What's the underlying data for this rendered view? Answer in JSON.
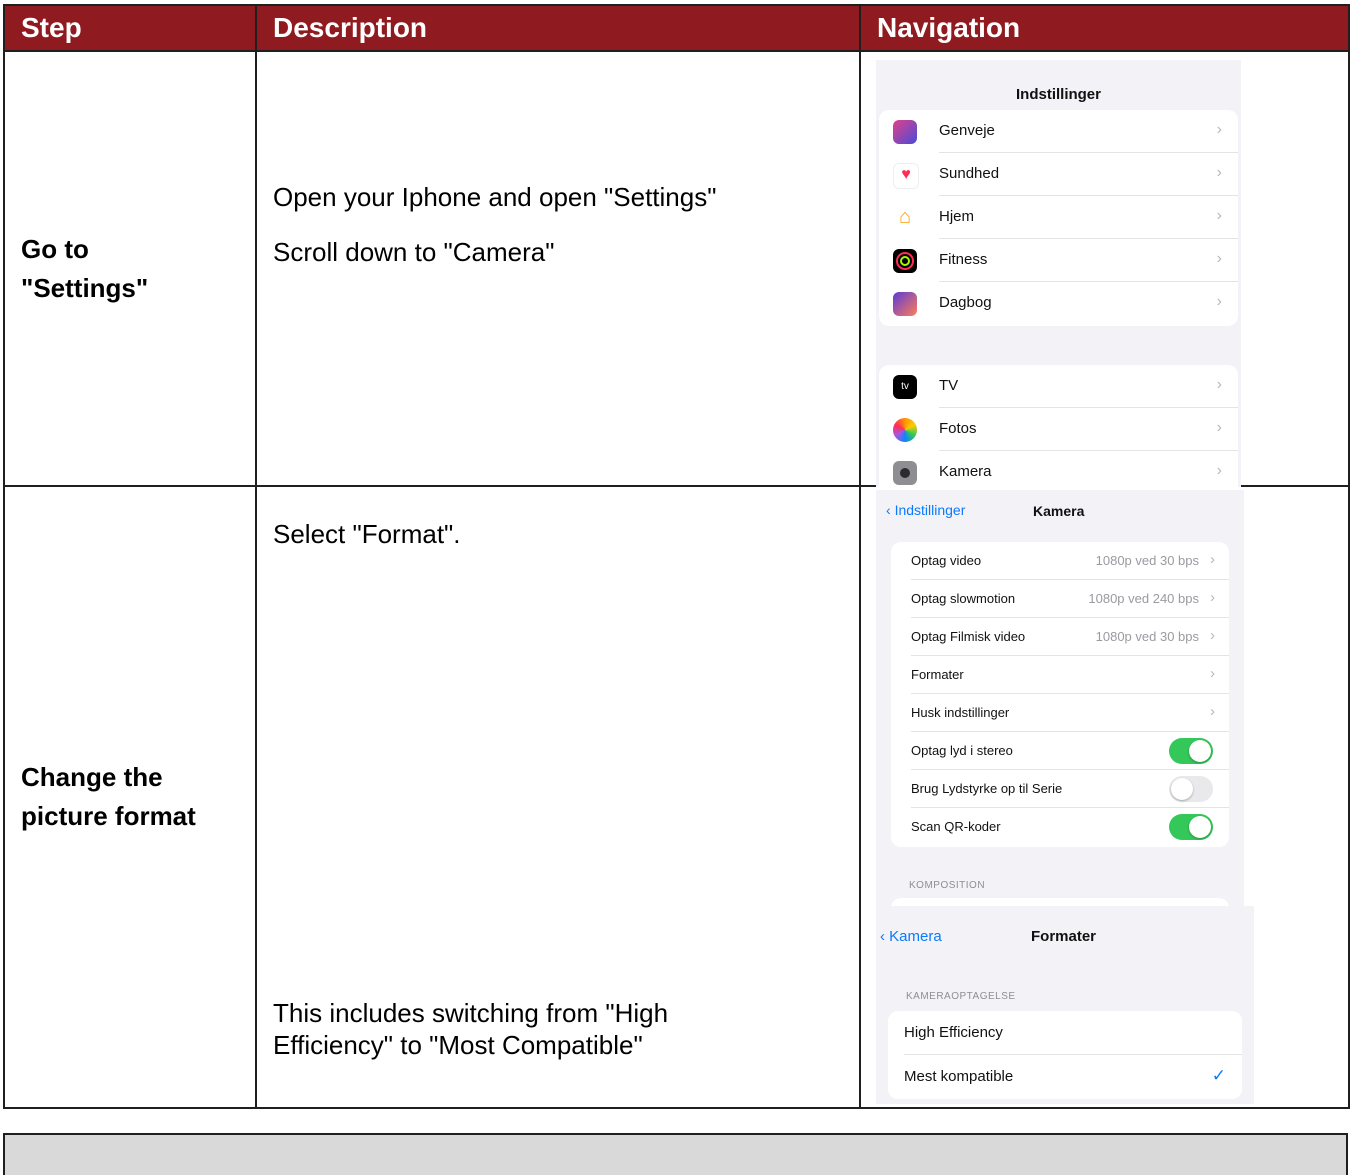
{
  "header": {
    "step": "Step",
    "description": "Description",
    "navigation": "Navigation"
  },
  "rows": [
    {
      "step": "Go to \"Settings\"",
      "desc1": "Open your Iphone and open \"Settings\"",
      "desc2": "Scroll down to \"Camera\"",
      "phone": {
        "title": "Indstillinger",
        "group1": [
          "Genveje",
          "Sundhed",
          "Hjem",
          "Fitness",
          "Dagbog"
        ],
        "group2": [
          "TV",
          "Fotos",
          "Kamera"
        ]
      }
    },
    {
      "step": "Change the picture format",
      "desc1": "Select \"Format\".",
      "desc2": "This includes switching from \"High Efficiency\" to \"Most Compatible\"",
      "camera": {
        "back": "Indstillinger",
        "title": "Kamera",
        "items": [
          {
            "label": "Optag video",
            "value": "1080p ved 30 bps"
          },
          {
            "label": "Optag slowmotion",
            "value": "1080p ved 240 bps"
          },
          {
            "label": "Optag Filmisk video",
            "value": "1080p ved 30 bps"
          },
          {
            "label": "Formater",
            "value": ""
          },
          {
            "label": "Husk indstillinger",
            "value": ""
          },
          {
            "label": "Optag lyd i stereo",
            "toggle": true
          },
          {
            "label": "Brug Lydstyrke op til Serie",
            "toggle": false
          },
          {
            "label": "Scan QR-koder",
            "toggle": true
          }
        ],
        "section": "KOMPOSITION"
      },
      "formats": {
        "back": "Kamera",
        "title": "Formater",
        "section": "KAMERAOPTAGELSE",
        "options": [
          "High Efficiency",
          "Mest kompatible"
        ],
        "selected": "Mest kompatible"
      }
    }
  ],
  "colors": {
    "header_bg": "#8f1a1f",
    "footer_bg": "#d9d9d9",
    "toggle_on": "#34c759",
    "ios_blue": "#0a7aff"
  }
}
